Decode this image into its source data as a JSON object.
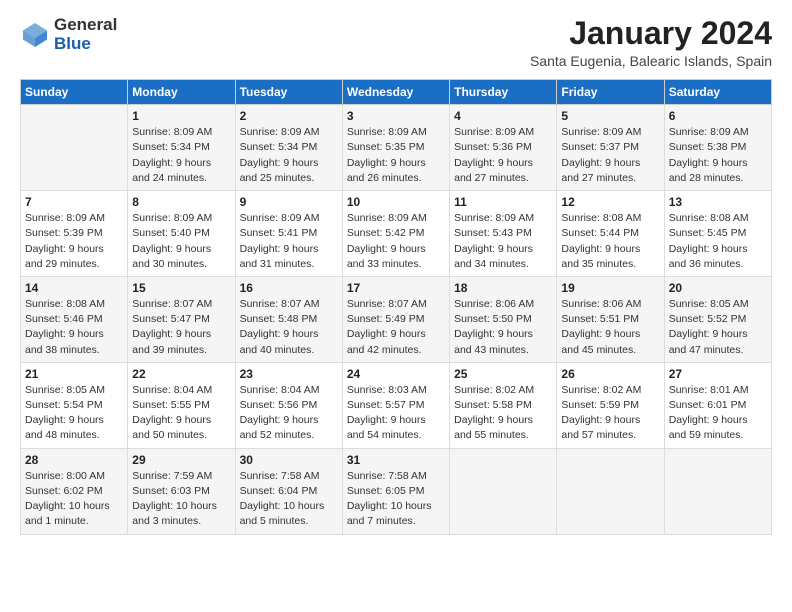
{
  "header": {
    "logo_line1": "General",
    "logo_line2": "Blue",
    "month_title": "January 2024",
    "subtitle": "Santa Eugenia, Balearic Islands, Spain"
  },
  "columns": [
    "Sunday",
    "Monday",
    "Tuesday",
    "Wednesday",
    "Thursday",
    "Friday",
    "Saturday"
  ],
  "weeks": [
    [
      {
        "day": "",
        "sunrise": "",
        "sunset": "",
        "daylight": ""
      },
      {
        "day": "1",
        "sunrise": "Sunrise: 8:09 AM",
        "sunset": "Sunset: 5:34 PM",
        "daylight": "Daylight: 9 hours and 24 minutes."
      },
      {
        "day": "2",
        "sunrise": "Sunrise: 8:09 AM",
        "sunset": "Sunset: 5:34 PM",
        "daylight": "Daylight: 9 hours and 25 minutes."
      },
      {
        "day": "3",
        "sunrise": "Sunrise: 8:09 AM",
        "sunset": "Sunset: 5:35 PM",
        "daylight": "Daylight: 9 hours and 26 minutes."
      },
      {
        "day": "4",
        "sunrise": "Sunrise: 8:09 AM",
        "sunset": "Sunset: 5:36 PM",
        "daylight": "Daylight: 9 hours and 27 minutes."
      },
      {
        "day": "5",
        "sunrise": "Sunrise: 8:09 AM",
        "sunset": "Sunset: 5:37 PM",
        "daylight": "Daylight: 9 hours and 27 minutes."
      },
      {
        "day": "6",
        "sunrise": "Sunrise: 8:09 AM",
        "sunset": "Sunset: 5:38 PM",
        "daylight": "Daylight: 9 hours and 28 minutes."
      }
    ],
    [
      {
        "day": "7",
        "sunrise": "Sunrise: 8:09 AM",
        "sunset": "Sunset: 5:39 PM",
        "daylight": "Daylight: 9 hours and 29 minutes."
      },
      {
        "day": "8",
        "sunrise": "Sunrise: 8:09 AM",
        "sunset": "Sunset: 5:40 PM",
        "daylight": "Daylight: 9 hours and 30 minutes."
      },
      {
        "day": "9",
        "sunrise": "Sunrise: 8:09 AM",
        "sunset": "Sunset: 5:41 PM",
        "daylight": "Daylight: 9 hours and 31 minutes."
      },
      {
        "day": "10",
        "sunrise": "Sunrise: 8:09 AM",
        "sunset": "Sunset: 5:42 PM",
        "daylight": "Daylight: 9 hours and 33 minutes."
      },
      {
        "day": "11",
        "sunrise": "Sunrise: 8:09 AM",
        "sunset": "Sunset: 5:43 PM",
        "daylight": "Daylight: 9 hours and 34 minutes."
      },
      {
        "day": "12",
        "sunrise": "Sunrise: 8:08 AM",
        "sunset": "Sunset: 5:44 PM",
        "daylight": "Daylight: 9 hours and 35 minutes."
      },
      {
        "day": "13",
        "sunrise": "Sunrise: 8:08 AM",
        "sunset": "Sunset: 5:45 PM",
        "daylight": "Daylight: 9 hours and 36 minutes."
      }
    ],
    [
      {
        "day": "14",
        "sunrise": "Sunrise: 8:08 AM",
        "sunset": "Sunset: 5:46 PM",
        "daylight": "Daylight: 9 hours and 38 minutes."
      },
      {
        "day": "15",
        "sunrise": "Sunrise: 8:07 AM",
        "sunset": "Sunset: 5:47 PM",
        "daylight": "Daylight: 9 hours and 39 minutes."
      },
      {
        "day": "16",
        "sunrise": "Sunrise: 8:07 AM",
        "sunset": "Sunset: 5:48 PM",
        "daylight": "Daylight: 9 hours and 40 minutes."
      },
      {
        "day": "17",
        "sunrise": "Sunrise: 8:07 AM",
        "sunset": "Sunset: 5:49 PM",
        "daylight": "Daylight: 9 hours and 42 minutes."
      },
      {
        "day": "18",
        "sunrise": "Sunrise: 8:06 AM",
        "sunset": "Sunset: 5:50 PM",
        "daylight": "Daylight: 9 hours and 43 minutes."
      },
      {
        "day": "19",
        "sunrise": "Sunrise: 8:06 AM",
        "sunset": "Sunset: 5:51 PM",
        "daylight": "Daylight: 9 hours and 45 minutes."
      },
      {
        "day": "20",
        "sunrise": "Sunrise: 8:05 AM",
        "sunset": "Sunset: 5:52 PM",
        "daylight": "Daylight: 9 hours and 47 minutes."
      }
    ],
    [
      {
        "day": "21",
        "sunrise": "Sunrise: 8:05 AM",
        "sunset": "Sunset: 5:54 PM",
        "daylight": "Daylight: 9 hours and 48 minutes."
      },
      {
        "day": "22",
        "sunrise": "Sunrise: 8:04 AM",
        "sunset": "Sunset: 5:55 PM",
        "daylight": "Daylight: 9 hours and 50 minutes."
      },
      {
        "day": "23",
        "sunrise": "Sunrise: 8:04 AM",
        "sunset": "Sunset: 5:56 PM",
        "daylight": "Daylight: 9 hours and 52 minutes."
      },
      {
        "day": "24",
        "sunrise": "Sunrise: 8:03 AM",
        "sunset": "Sunset: 5:57 PM",
        "daylight": "Daylight: 9 hours and 54 minutes."
      },
      {
        "day": "25",
        "sunrise": "Sunrise: 8:02 AM",
        "sunset": "Sunset: 5:58 PM",
        "daylight": "Daylight: 9 hours and 55 minutes."
      },
      {
        "day": "26",
        "sunrise": "Sunrise: 8:02 AM",
        "sunset": "Sunset: 5:59 PM",
        "daylight": "Daylight: 9 hours and 57 minutes."
      },
      {
        "day": "27",
        "sunrise": "Sunrise: 8:01 AM",
        "sunset": "Sunset: 6:01 PM",
        "daylight": "Daylight: 9 hours and 59 minutes."
      }
    ],
    [
      {
        "day": "28",
        "sunrise": "Sunrise: 8:00 AM",
        "sunset": "Sunset: 6:02 PM",
        "daylight": "Daylight: 10 hours and 1 minute."
      },
      {
        "day": "29",
        "sunrise": "Sunrise: 7:59 AM",
        "sunset": "Sunset: 6:03 PM",
        "daylight": "Daylight: 10 hours and 3 minutes."
      },
      {
        "day": "30",
        "sunrise": "Sunrise: 7:58 AM",
        "sunset": "Sunset: 6:04 PM",
        "daylight": "Daylight: 10 hours and 5 minutes."
      },
      {
        "day": "31",
        "sunrise": "Sunrise: 7:58 AM",
        "sunset": "Sunset: 6:05 PM",
        "daylight": "Daylight: 10 hours and 7 minutes."
      },
      {
        "day": "",
        "sunrise": "",
        "sunset": "",
        "daylight": ""
      },
      {
        "day": "",
        "sunrise": "",
        "sunset": "",
        "daylight": ""
      },
      {
        "day": "",
        "sunrise": "",
        "sunset": "",
        "daylight": ""
      }
    ]
  ]
}
